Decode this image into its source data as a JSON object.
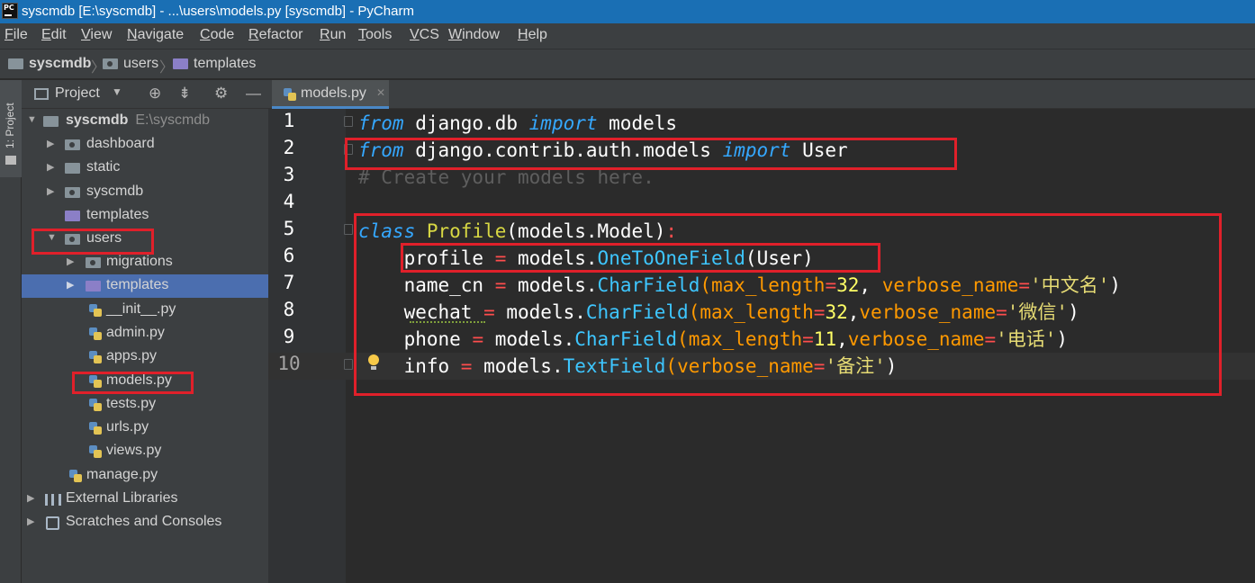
{
  "window": {
    "title": "syscmdb [E:\\syscmdb] - ...\\users\\models.py [syscmdb] - PyCharm",
    "app_icon_text": "PC"
  },
  "menu": [
    {
      "label": "File",
      "u": "F",
      "rest": "ile"
    },
    {
      "label": "Edit",
      "u": "E",
      "rest": "dit"
    },
    {
      "label": "View",
      "u": "V",
      "rest": "iew"
    },
    {
      "label": "Navigate",
      "u": "N",
      "rest": "avigate"
    },
    {
      "label": "Code",
      "u": "C",
      "rest": "ode"
    },
    {
      "label": "Refactor",
      "u": "R",
      "rest": "efactor"
    },
    {
      "label": "Run",
      "u": "R",
      "rest": "un"
    },
    {
      "label": "Tools",
      "u": "T",
      "rest": "ools"
    },
    {
      "label": "VCS",
      "u": "V",
      "rest": "CS"
    },
    {
      "label": "Window",
      "u": "W",
      "rest": "indow"
    },
    {
      "label": "Help",
      "u": "H",
      "rest": "elp"
    }
  ],
  "breadcrumb": [
    "syscmdb",
    "users",
    "templates"
  ],
  "toolstrip": {
    "project_tab": "1: Project"
  },
  "project_panel": {
    "header_label": "Project",
    "tree": [
      {
        "label": "syscmdb",
        "hint": "E:\\syscmdb",
        "type": "folder"
      },
      {
        "label": "dashboard",
        "type": "folder"
      },
      {
        "label": "static",
        "type": "folder"
      },
      {
        "label": "syscmdb",
        "type": "folder"
      },
      {
        "label": "templates",
        "type": "folder"
      },
      {
        "label": "users",
        "type": "folder"
      },
      {
        "label": "migrations",
        "type": "folder"
      },
      {
        "label": "templates",
        "type": "folder"
      },
      {
        "label": "__init__.py",
        "type": "py"
      },
      {
        "label": "admin.py",
        "type": "py"
      },
      {
        "label": "apps.py",
        "type": "py"
      },
      {
        "label": "models.py",
        "type": "py"
      },
      {
        "label": "tests.py",
        "type": "py"
      },
      {
        "label": "urls.py",
        "type": "py"
      },
      {
        "label": "views.py",
        "type": "py"
      },
      {
        "label": "manage.py",
        "type": "py"
      },
      {
        "label": "External Libraries",
        "type": "libs"
      },
      {
        "label": "Scratches and Consoles",
        "type": "scratch"
      }
    ]
  },
  "editor": {
    "tab_label": "models.py",
    "line_numbers": [
      "1",
      "2",
      "3",
      "4",
      "5",
      "6",
      "7",
      "8",
      "9",
      "10"
    ],
    "code": {
      "l1": {
        "kw1": "from",
        "mod": " django.db ",
        "kw2": "import",
        "name": " models"
      },
      "l2": {
        "kw1": "from",
        "mod": " django.contrib.auth.models ",
        "kw2": "import",
        "name": " User"
      },
      "l3": {
        "comment": "# Create your models here."
      },
      "l5": {
        "kw": "class",
        "sp": " ",
        "cls": "Profile",
        "base": "(models.Model)",
        "colon": ":"
      },
      "l6": {
        "indent": "    ",
        "field": "profile",
        "eq": " = ",
        "mod": "models.",
        "call": "OneToOneField",
        "args": "(User)"
      },
      "l7": {
        "indent": "    ",
        "field": "name_cn",
        "eq": " = ",
        "mod": "models.",
        "call": "CharField",
        "p1": "max_length",
        "e1": "=",
        "n1": "32",
        "c1": ", ",
        "p2": "verbose_name",
        "e2": "=",
        "s1": "'中文名'",
        "close": ")"
      },
      "l8": {
        "indent": "    ",
        "field": "wechat",
        "eq": " = ",
        "mod": "models.",
        "call": "CharField",
        "p1": "max_length",
        "e1": "=",
        "n1": "32",
        "c1": ",",
        "p2": "verbose_name",
        "e2": "=",
        "s1": "'微信'",
        "close": ")"
      },
      "l9": {
        "indent": "    ",
        "field": "phone",
        "eq": " = ",
        "mod": "models.",
        "call": "CharField",
        "p1": "max_length",
        "e1": "=",
        "n1": "11",
        "c1": ",",
        "p2": "verbose_name",
        "e2": "=",
        "s1": "'电话'",
        "close": ")"
      },
      "l10": {
        "indent": "    ",
        "field": "info",
        "eq": " = ",
        "mod": "models.",
        "call": "TextField",
        "p2": "verbose_name",
        "e2": "=",
        "s1": "'备注'",
        "close": ")"
      }
    }
  }
}
